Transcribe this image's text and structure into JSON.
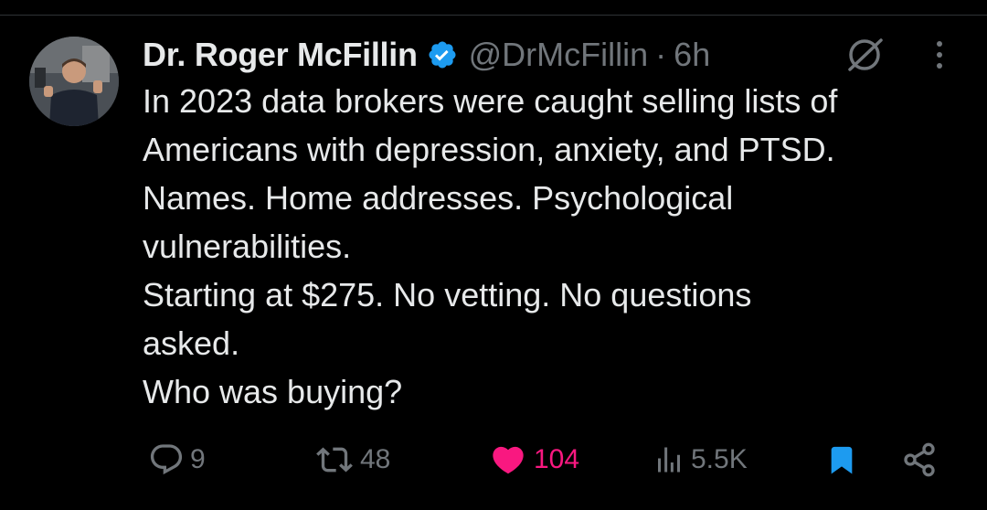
{
  "author": {
    "display_name": "Dr. Roger McFillin",
    "handle": "@DrMcFillin",
    "separator": "·",
    "time": "6h",
    "verified_color": "#1d9bf0"
  },
  "tweet": {
    "lines": [
      "In 2023 data brokers were caught selling lists of",
      "Americans with depression, anxiety, and PTSD.",
      "Names. Home addresses. Psychological",
      "vulnerabilities.",
      "Starting at $275. No vetting. No questions",
      "asked.",
      "Who was buying?"
    ]
  },
  "actions": {
    "replies": "9",
    "reposts": "48",
    "likes": "104",
    "views": "5.5K"
  },
  "icons": {
    "verified": "verified-badge-icon",
    "grok": "grok-icon",
    "more": "more-vertical-icon",
    "reply": "reply-icon",
    "repost": "repost-icon",
    "like": "heart-icon",
    "views": "views-icon",
    "bookmark": "bookmark-icon",
    "share": "share-icon"
  },
  "colors": {
    "background": "#000000",
    "text": "#e7e9ea",
    "muted": "#71767b",
    "like": "#f91880",
    "bookmark": "#1d9bf0"
  }
}
